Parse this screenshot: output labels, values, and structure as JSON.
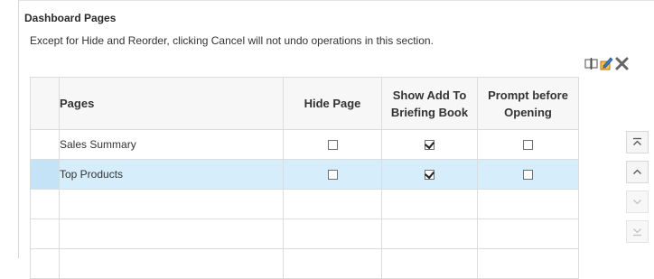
{
  "section": {
    "title": "Dashboard Pages",
    "note": "Except for Hide and Reorder, clicking Cancel will not undo operations in this section."
  },
  "toolbar": {
    "icons": [
      "rename-icon",
      "edit-properties-icon",
      "delete-icon"
    ]
  },
  "table": {
    "headers": {
      "pages": "Pages",
      "hide_page": "Hide Page",
      "show_add_line1": "Show Add To",
      "show_add_line2": "Briefing Book",
      "prompt_line1": "Prompt before",
      "prompt_line2": "Opening"
    },
    "rows": [
      {
        "name": "Sales Summary",
        "hide": false,
        "show_add": true,
        "prompt": false,
        "selected": false
      },
      {
        "name": "Top Products",
        "hide": false,
        "show_add": true,
        "prompt": false,
        "selected": true
      }
    ]
  },
  "reorder": {
    "buttons": [
      "move-to-top-icon",
      "move-up-icon",
      "move-down-icon",
      "move-to-bottom-icon"
    ],
    "enabled": [
      true,
      true,
      false,
      false
    ]
  }
}
